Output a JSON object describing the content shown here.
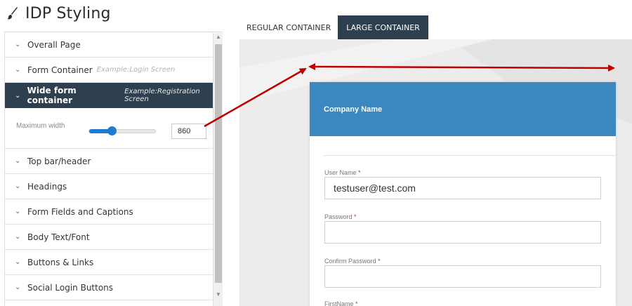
{
  "title": {
    "text": "IDP Styling",
    "icon": "paintbrush-icon"
  },
  "panel": {
    "sections_top": [
      {
        "label": "Overall Page",
        "example": ""
      },
      {
        "label": "Form Container",
        "example": "Example:Login Screen"
      }
    ],
    "active_section": {
      "label": "Wide form container",
      "example": "Example:Registration Screen"
    },
    "max_width": {
      "label": "Maximum width",
      "value": "860",
      "slider_fraction": 0.33
    },
    "sections_bottom": [
      {
        "label": "Top bar/header"
      },
      {
        "label": "Headings"
      },
      {
        "label": "Form Fields and Captions"
      },
      {
        "label": "Body Text/Font"
      },
      {
        "label": "Buttons & Links"
      },
      {
        "label": "Social Login Buttons"
      }
    ]
  },
  "tabs": [
    {
      "label": "REGULAR CONTAINER",
      "active": false
    },
    {
      "label": "LARGE CONTAINER",
      "active": true
    }
  ],
  "form": {
    "header": "Company Name",
    "fields": [
      {
        "label": "User Name",
        "required": "*",
        "value": "testuser@test.com"
      },
      {
        "label": "Password",
        "required": "*",
        "value": ""
      },
      {
        "label": "Confirm Password",
        "required": "*",
        "value": ""
      },
      {
        "label": "FirstName",
        "required": "*",
        "value": ""
      }
    ]
  },
  "colors": {
    "accent": "#2e4050",
    "header": "#3b87bf",
    "slider": "#1f7bd1",
    "annotation": "#c00000"
  }
}
